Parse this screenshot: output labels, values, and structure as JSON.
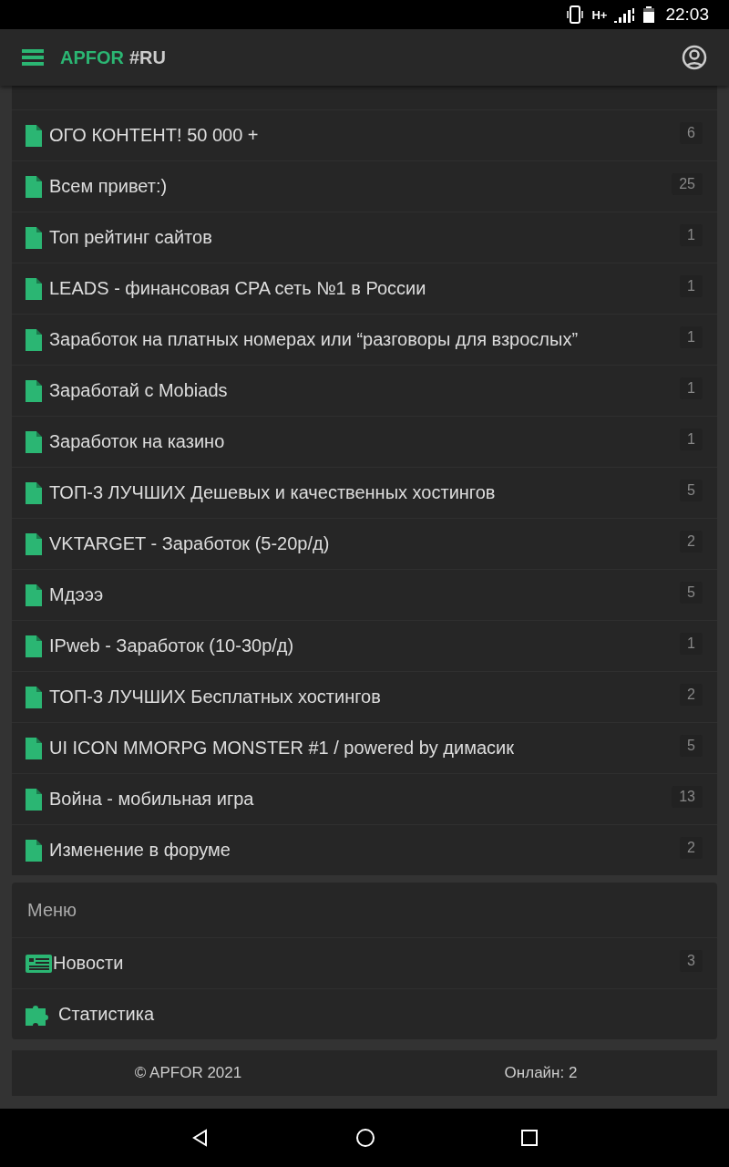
{
  "status_bar": {
    "network": "H+",
    "time": "22:03"
  },
  "app_bar": {
    "brand": "APFOR",
    "tag": "#RU"
  },
  "topics": [
    {
      "title": "ОГО КОНТЕНТ! 50 000 +",
      "count": "6"
    },
    {
      "title": "Всем привет:)",
      "count": "25"
    },
    {
      "title": "Топ рейтинг сайтов",
      "count": "1"
    },
    {
      "title": "LEADS - финансовая CPA сеть №1 в России",
      "count": "1"
    },
    {
      "title": "Заработок на платных номерах или “разговоры для взрослых”",
      "count": "1"
    },
    {
      "title": "Заработай с Mobiads",
      "count": "1"
    },
    {
      "title": "Заработок на казино",
      "count": "1"
    },
    {
      "title": "ТОП-3 ЛУЧШИХ Дешевых и качественных хостингов",
      "count": "5"
    },
    {
      "title": "VKTARGET - Заработок (5-20р/д)",
      "count": "2"
    },
    {
      "title": "Мдэээ",
      "count": "5"
    },
    {
      "title": "IPweb - Заработок (10-30р/д)",
      "count": "1"
    },
    {
      "title": "ТОП-3 ЛУЧШИХ Бесплатных хостингов",
      "count": "2"
    },
    {
      "title": "UI ICON MMORPG MONSTER #1 / powered by димасик",
      "count": "5"
    },
    {
      "title": "Война - мобильная игра",
      "count": "13"
    },
    {
      "title": "Изменение в форуме",
      "count": "2"
    }
  ],
  "menu": {
    "title": "Меню",
    "items": [
      {
        "kind": "news",
        "label": "Новости",
        "count": "3"
      },
      {
        "kind": "stats",
        "label": "Статистика"
      }
    ]
  },
  "footer": {
    "copyright": "© APFOR 2021",
    "online": "Онлайн: 2"
  }
}
